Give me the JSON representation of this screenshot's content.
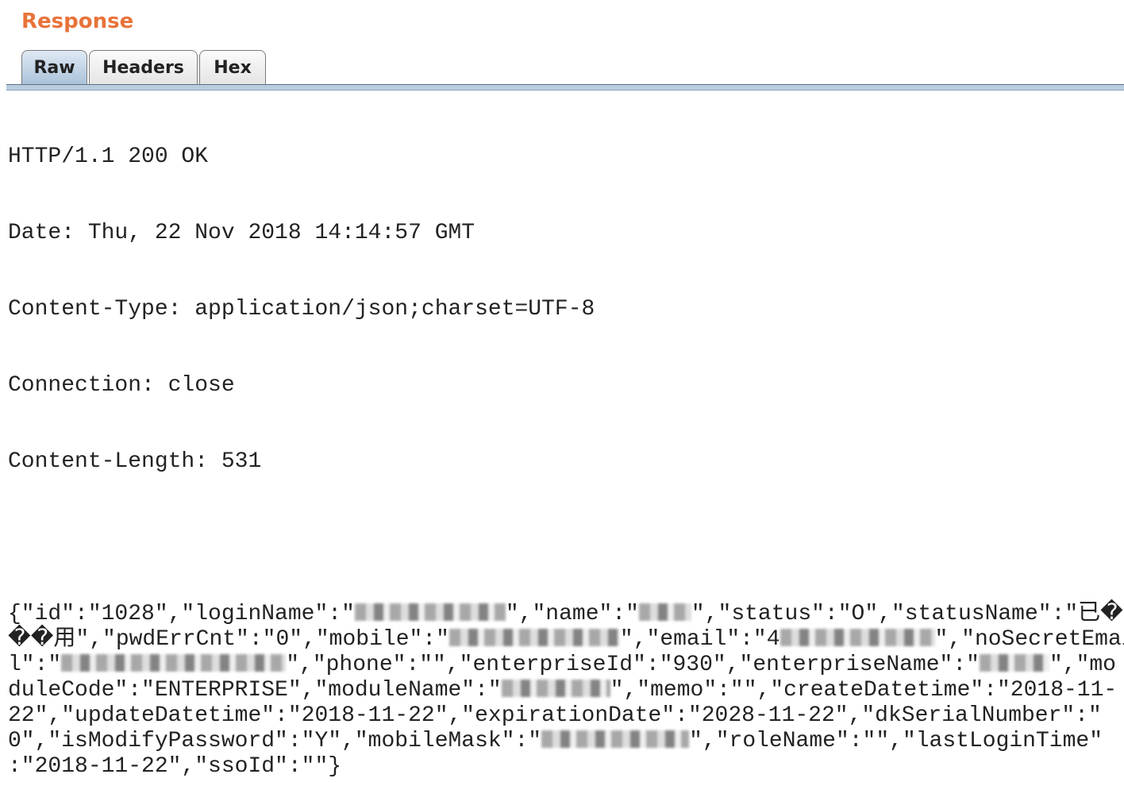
{
  "panel": {
    "title": "Response"
  },
  "tabs": [
    {
      "label": "Raw",
      "active": true
    },
    {
      "label": "Headers",
      "active": false
    },
    {
      "label": "Hex",
      "active": false
    }
  ],
  "headers": [
    "HTTP/1.1 200 OK",
    "Date: Thu, 22 Nov 2018 14:14:57 GMT",
    "Content-Type: application/json;charset=UTF-8",
    "Connection: close",
    "Content-Length: 531"
  ],
  "body": [
    [
      {
        "t": "{\"id\":\"1028\",\"loginName\":\""
      },
      {
        "r": "loginName"
      },
      {
        "t": "\",\"name\":\""
      },
      {
        "r": "name"
      },
      {
        "t": "\",\"status\":\"O\",\"statusName\":\"已�"
      }
    ],
    [
      {
        "t": "��用\",\"pwdErrCnt\":\"0\",\"mobile\":\""
      },
      {
        "r": "mobile"
      },
      {
        "t": "\",\"email\":\"4"
      },
      {
        "r": "email"
      },
      {
        "t": "\",\"noSecretEmai"
      }
    ],
    [
      {
        "t": "l\":\""
      },
      {
        "r": "noSecretEmail"
      },
      {
        "t": "\",\"phone\":\"\",\"enterpriseId\":\"930\",\"enterpriseName\":\""
      },
      {
        "r": "enterpriseName"
      },
      {
        "t": "\",\"mo"
      }
    ],
    [
      {
        "t": "duleCode\":\"ENTERPRISE\",\"moduleName\":\""
      },
      {
        "r": "moduleName"
      },
      {
        "t": "\",\"memo\":\"\",\"createDatetime\":\"2018-11-"
      }
    ],
    [
      {
        "t": "22\",\"updateDatetime\":\"2018-11-22\",\"expirationDate\":\"2028-11-22\",\"dkSerialNumber\":\""
      }
    ],
    [
      {
        "t": "0\",\"isModifyPassword\":\"Y\",\"mobileMask\":\""
      },
      {
        "r": "mobileMask"
      },
      {
        "t": "\",\"roleName\":\"\",\"lastLoginTime\""
      }
    ],
    [
      {
        "t": ":\"2018-11-22\",\"ssoId\":\"\"}"
      }
    ]
  ]
}
